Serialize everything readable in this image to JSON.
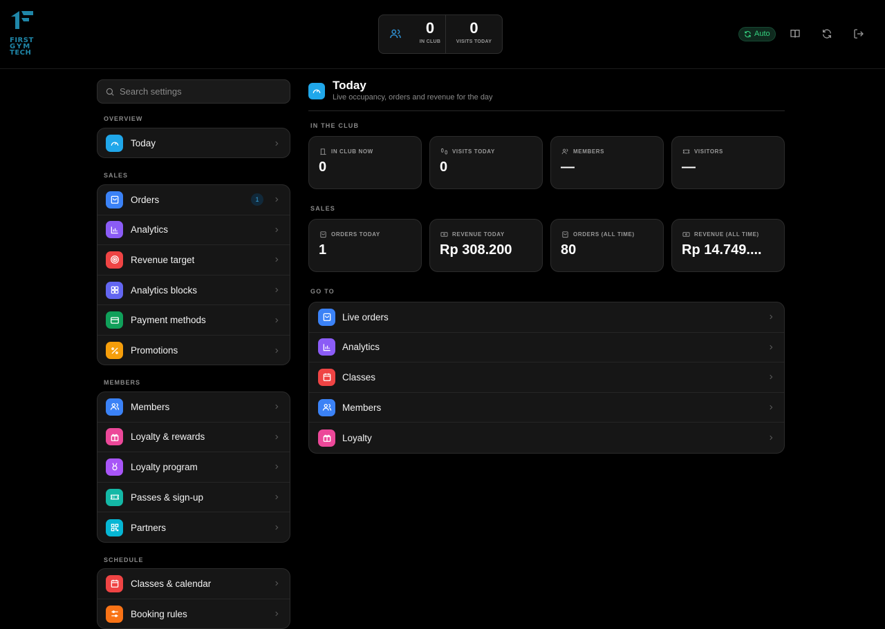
{
  "brand": {
    "logo_lines": [
      "FIRST",
      "GYM",
      "TECH"
    ],
    "accent": "#1f86a8"
  },
  "top_stats": {
    "in_club_value": "0",
    "in_club_label": "IN CLUB",
    "visits_value": "0",
    "visits_label": "VISITS TODAY"
  },
  "toolbar": {
    "auto_label": "Auto",
    "icons": [
      "refresh-auto-icon",
      "book-icon",
      "refresh-icon",
      "logout-icon"
    ]
  },
  "sidebar": {
    "search_placeholder": "Search settings",
    "sections": [
      {
        "label": "OVERVIEW",
        "items": [
          {
            "label": "Today",
            "icon": "gauge-icon",
            "color": "#20a7ea"
          }
        ]
      },
      {
        "label": "SALES",
        "items": [
          {
            "label": "Orders",
            "icon": "bag-icon",
            "color": "#3b82f6",
            "badge": "1"
          },
          {
            "label": "Analytics",
            "icon": "bar-chart-icon",
            "color": "#8b5cf6"
          },
          {
            "label": "Revenue target",
            "icon": "target-icon",
            "color": "#ef4444"
          },
          {
            "label": "Analytics blocks",
            "icon": "grid-icon",
            "color": "#6366f1"
          },
          {
            "label": "Payment methods",
            "icon": "card-icon",
            "color": "#10a05a"
          },
          {
            "label": "Promotions",
            "icon": "percent-icon",
            "color": "#f59e0b"
          }
        ]
      },
      {
        "label": "MEMBERS",
        "items": [
          {
            "label": "Members",
            "icon": "users-icon",
            "color": "#3b82f6"
          },
          {
            "label": "Loyalty & rewards",
            "icon": "gift-icon",
            "color": "#ec4899"
          },
          {
            "label": "Loyalty program",
            "icon": "medal-icon",
            "color": "#a855f7"
          },
          {
            "label": "Passes & sign-up",
            "icon": "ticket-icon",
            "color": "#14b8a6"
          },
          {
            "label": "Partners",
            "icon": "qr-icon",
            "color": "#06b6d4"
          }
        ]
      },
      {
        "label": "SCHEDULE",
        "items": [
          {
            "label": "Classes & calendar",
            "icon": "calendar-icon",
            "color": "#ef4444"
          },
          {
            "label": "Booking rules",
            "icon": "sliders-icon",
            "color": "#f97316"
          }
        ]
      }
    ]
  },
  "main": {
    "title": "Today",
    "subtitle": "Live occupancy, orders and revenue for the day",
    "in_club": {
      "label": "IN THE CLUB",
      "cards": [
        {
          "label": "IN CLUB NOW",
          "value": "0",
          "icon": "door-icon"
        },
        {
          "label": "VISITS TODAY",
          "value": "0",
          "icon": "footprints-icon"
        },
        {
          "label": "MEMBERS",
          "value": "—",
          "icon": "users-icon"
        },
        {
          "label": "VISITORS",
          "value": "—",
          "icon": "ticket-icon"
        }
      ]
    },
    "sales": {
      "label": "SALES",
      "cards": [
        {
          "label": "ORDERS TODAY",
          "value": "1",
          "icon": "bag-icon"
        },
        {
          "label": "REVENUE TODAY",
          "value": "Rp 308.200",
          "icon": "cash-icon"
        },
        {
          "label": "ORDERS (ALL TIME)",
          "value": "80",
          "icon": "bag-icon"
        },
        {
          "label": "REVENUE (ALL TIME)",
          "value": "Rp 14.749....",
          "icon": "cash-icon"
        }
      ]
    },
    "goto": {
      "label": "GO TO",
      "items": [
        {
          "label": "Live orders",
          "icon": "bag-icon",
          "color": "#3b82f6"
        },
        {
          "label": "Analytics",
          "icon": "bar-chart-icon",
          "color": "#8b5cf6"
        },
        {
          "label": "Classes",
          "icon": "calendar-icon",
          "color": "#ef4444"
        },
        {
          "label": "Members",
          "icon": "users-icon",
          "color": "#3b82f6"
        },
        {
          "label": "Loyalty",
          "icon": "gift-icon",
          "color": "#ec4899"
        }
      ]
    }
  }
}
